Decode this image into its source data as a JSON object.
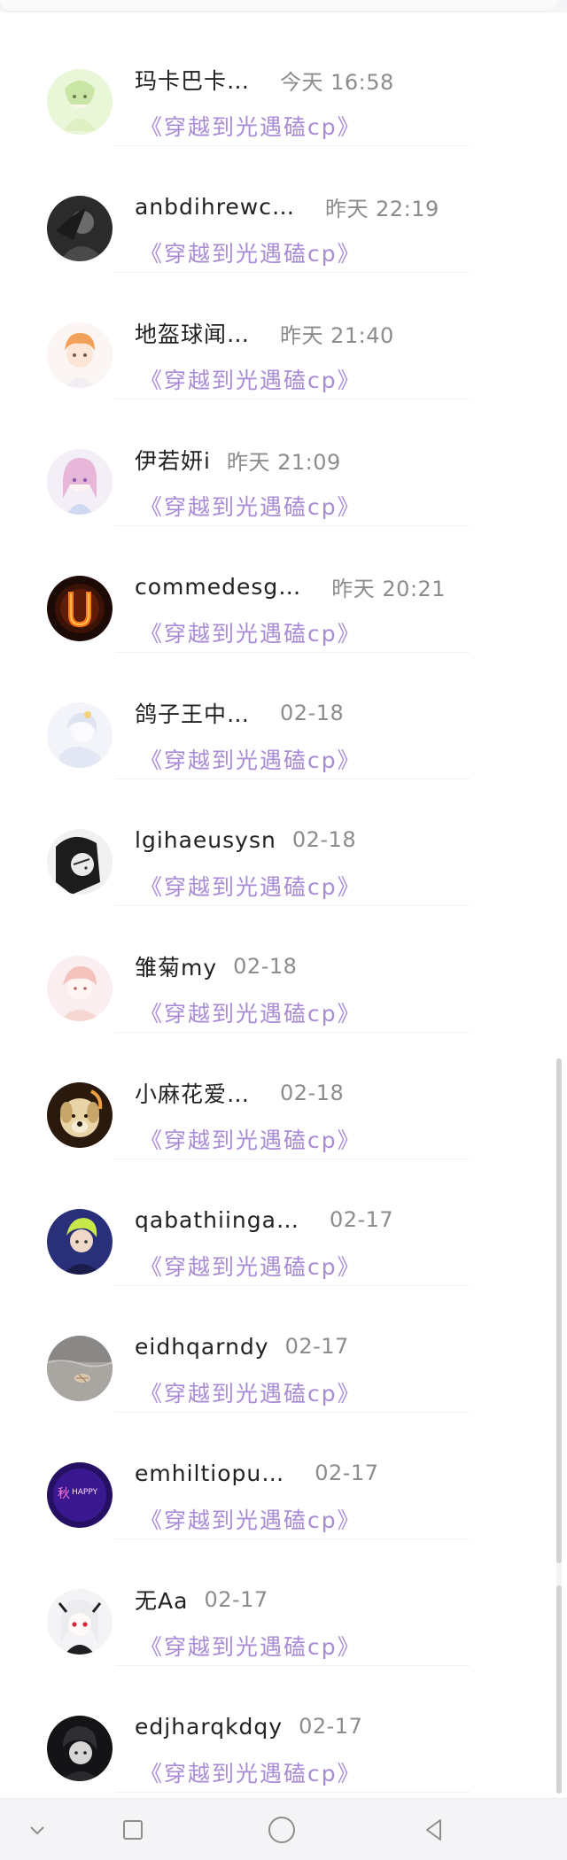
{
  "conversations": [
    {
      "name": "玛卡巴卡…",
      "time": "今天 16:58",
      "group": "《穿越到光遇磕cp》",
      "avatar_icon": "anime-girl-green-avatar",
      "time_style": "wide"
    },
    {
      "name": "anbdihrewc…",
      "time": "昨天 22:19",
      "group": "《穿越到光遇磕cp》",
      "avatar_icon": "dark-photo-avatar",
      "time_style": "wide"
    },
    {
      "name": "地盔球闻…",
      "time": "昨天 21:40",
      "group": "《穿越到光遇磕cp》",
      "avatar_icon": "orange-hair-boy-avatar",
      "time_style": "wide"
    },
    {
      "name": "伊若妍i",
      "time": "昨天 21:09",
      "group": "《穿越到光遇磕cp》",
      "avatar_icon": "pink-anime-girl-avatar",
      "time_style": "tight"
    },
    {
      "name": "commedesg…",
      "time": "昨天 20:21",
      "group": "《穿越到光遇磕cp》",
      "avatar_icon": "fire-letter-u-avatar",
      "time_style": "wide"
    },
    {
      "name": "鸽子王中…",
      "time": "02-18",
      "group": "《穿越到光遇磕cp》",
      "avatar_icon": "white-anime-avatar",
      "time_style": "wide"
    },
    {
      "name": "lgihaeusysn",
      "time": "02-18",
      "group": "《穿越到光遇磕cp》",
      "avatar_icon": "bw-girl-avatar",
      "time_style": "tight"
    },
    {
      "name": "雏菊my",
      "time": "02-18",
      "group": "《穿越到光遇磕cp》",
      "avatar_icon": "pastel-girl-avatar",
      "time_style": "tight"
    },
    {
      "name": "小麻花爱…",
      "time": "02-18",
      "group": "《穿越到光遇磕cp》",
      "avatar_icon": "dog-avatar",
      "time_style": "wide"
    },
    {
      "name": "qabathiinga…",
      "time": "02-17",
      "group": "《穿越到光遇磕cp》",
      "avatar_icon": "neon-boy-avatar",
      "time_style": "wide"
    },
    {
      "name": "eidhqarndy",
      "time": "02-17",
      "group": "《穿越到光遇磕cp》",
      "avatar_icon": "beach-shell-avatar",
      "time_style": "tight"
    },
    {
      "name": "emhiltiopu…",
      "time": "02-17",
      "group": "《穿越到光遇磕cp》",
      "avatar_icon": "purple-text-logo-avatar",
      "time_style": "wide"
    },
    {
      "name": "无Aa",
      "time": "02-17",
      "group": "《穿越到光遇磕cp》",
      "avatar_icon": "white-hair-anime-avatar",
      "time_style": "tight"
    },
    {
      "name": "edjharqkdqy",
      "time": "02-17",
      "group": "《穿越到光遇磕cp》",
      "avatar_icon": "dark-anime-boy-avatar",
      "time_style": "tight"
    }
  ],
  "navbar": {
    "buttons": [
      {
        "name": "nav-hide-icon"
      },
      {
        "name": "nav-recents-icon"
      },
      {
        "name": "nav-home-icon"
      },
      {
        "name": "nav-back-icon"
      }
    ]
  },
  "colors": {
    "group_text": "#a98bd6",
    "name_text": "#222222",
    "time_text": "#8c8c8c"
  }
}
